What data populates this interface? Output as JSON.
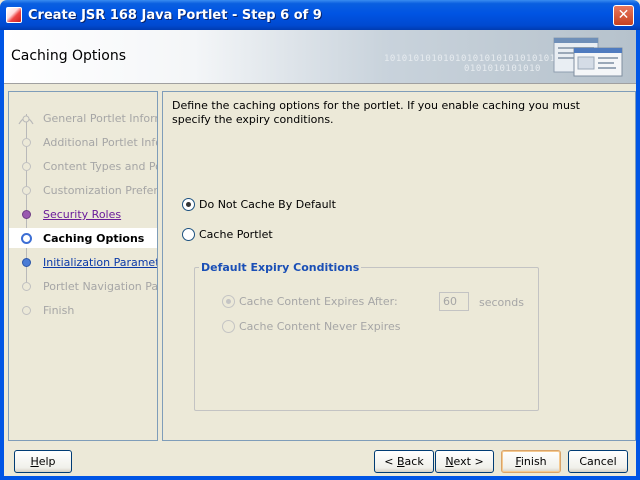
{
  "window": {
    "title": "Create JSR 168 Java Portlet - Step 6 of 9",
    "close_symbol": "✕"
  },
  "header": {
    "title": "Caching Options",
    "binary_line1": "10101010101010101010101010101",
    "binary_line2": "0101010101010"
  },
  "nav": {
    "items": [
      {
        "label": "General Portlet Information",
        "state": "done"
      },
      {
        "label": "Additional Portlet Information",
        "state": "done"
      },
      {
        "label": "Content Types and Portlet Modes",
        "state": "done"
      },
      {
        "label": "Customization Preferences",
        "state": "done"
      },
      {
        "label": "Security Roles",
        "state": "visited"
      },
      {
        "label": "Caching Options",
        "state": "current"
      },
      {
        "label": "Initialization Parameters",
        "state": "link"
      },
      {
        "label": "Portlet Navigation Parameters",
        "state": "disabled"
      },
      {
        "label": "Finish",
        "state": "disabled"
      }
    ],
    "scroll_left": "<",
    "scroll_right": ">"
  },
  "main": {
    "description": "Define the caching options for the portlet. If you enable caching you must specify the expiry conditions.",
    "radio_no_cache": "Do Not Cache By Default",
    "radio_cache": "Cache Portlet",
    "group_title": "Default Expiry Conditions",
    "radio_expires_after": "Cache Content Expires After:",
    "expires_value": "60",
    "seconds_label": "seconds",
    "radio_never_expires": "Cache Content Never Expires"
  },
  "buttons": {
    "help": {
      "pre": "",
      "mnemonic": "H",
      "post": "elp"
    },
    "back": {
      "pre": "< ",
      "mnemonic": "B",
      "post": "ack"
    },
    "next": {
      "pre": "",
      "mnemonic": "N",
      "post": "ext >"
    },
    "finish": {
      "pre": "",
      "mnemonic": "F",
      "post": "inish"
    },
    "cancel": {
      "pre": "Cancel",
      "mnemonic": "",
      "post": ""
    }
  },
  "colors": {
    "title_bar": "#0054e3",
    "current_step_marker": "#3c6ed4",
    "visited_link": "#6a1b9a",
    "link": "#0b3aa8",
    "group_title": "#1a4fb6"
  }
}
